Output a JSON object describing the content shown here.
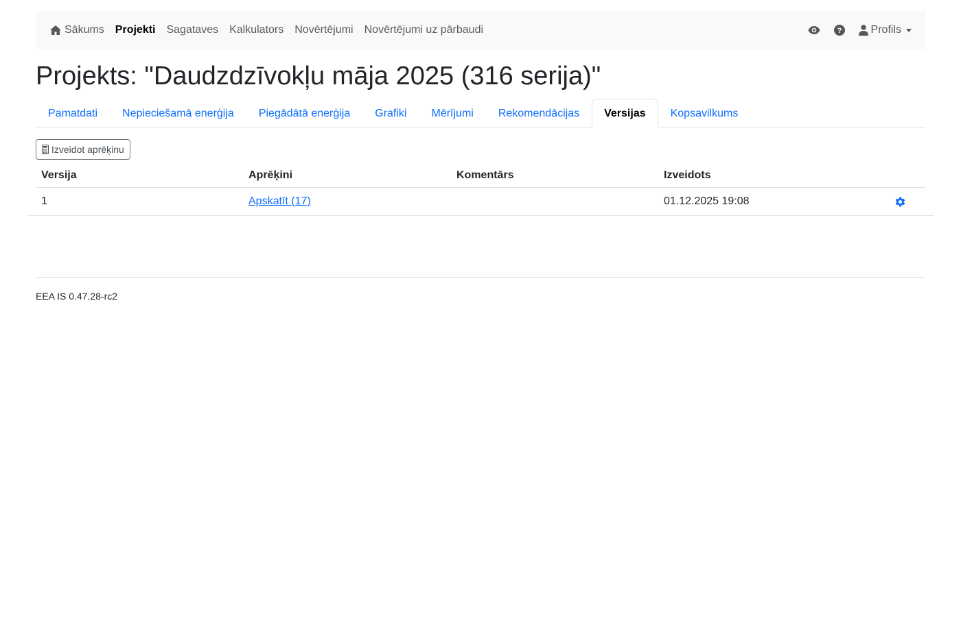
{
  "navbar": {
    "items": [
      {
        "label": "Sākums",
        "icon": "home-icon",
        "active": false
      },
      {
        "label": "Projekti",
        "active": true
      },
      {
        "label": "Sagataves",
        "active": false
      },
      {
        "label": "Kalkulators",
        "active": false
      },
      {
        "label": "Novērtējumi",
        "active": false
      },
      {
        "label": "Novērtējumi uz pārbaudi",
        "active": false
      }
    ],
    "right": {
      "view_icon": "eye-icon",
      "help_icon": "question-circle-icon",
      "profile_label": "Profils",
      "profile_icon": "user-icon"
    }
  },
  "page": {
    "title": "Projekts: \"Daudzdzīvokļu māja 2025 (316 serija)\""
  },
  "tabs": [
    {
      "label": "Pamatdati",
      "active": false
    },
    {
      "label": "Nepieciešamā enerģija",
      "active": false
    },
    {
      "label": "Piegādātā enerģija",
      "active": false
    },
    {
      "label": "Grafiki",
      "active": false
    },
    {
      "label": "Mērījumi",
      "active": false
    },
    {
      "label": "Rekomendācijas",
      "active": false
    },
    {
      "label": "Versijas",
      "active": true
    },
    {
      "label": "Kopsavilkums",
      "active": false
    }
  ],
  "toolbar": {
    "create_label": "Izveidot aprēķinu",
    "create_icon": "calculator-icon"
  },
  "table": {
    "headers": [
      "Versija",
      "Aprēķini",
      "Komentārs",
      "Izveidots",
      ""
    ],
    "rows": [
      {
        "version": "1",
        "calculations": "Apskatīt (17)",
        "comment": "",
        "created": "01.12.2025 19:08",
        "action_icon": "gear-icon"
      }
    ]
  },
  "footer": {
    "version": "EEA IS 0.47.28-rc2"
  },
  "colors": {
    "link": "#0d6efd",
    "navbar_bg": "#f8f9fa",
    "border": "#dee2e6"
  }
}
